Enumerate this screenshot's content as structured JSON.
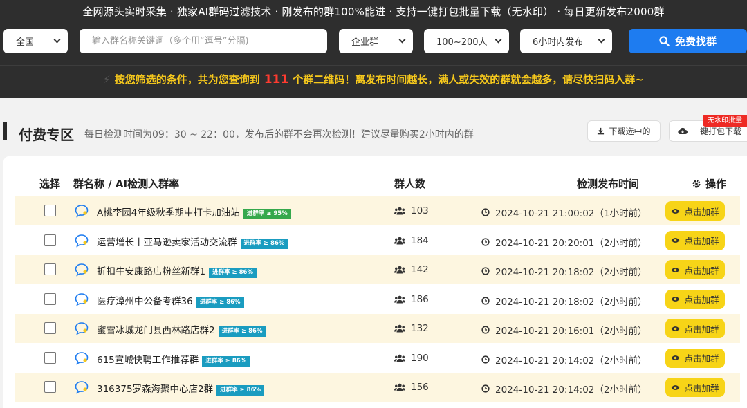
{
  "header": {
    "tagline": "全网源头实时采集 · 独家AI群码过滤技术 · 刚发布的群100%能进 · 支持一键打包批量下载（无水印） · 每日更新发布2000群"
  },
  "filters": {
    "region": "全国",
    "search_placeholder": "输入群名称关键词（多个用“逗号”分隔)",
    "group_type": "企业群",
    "member_range": "100~200人",
    "publish_time": "6小时内发布",
    "find_label": "免费找群"
  },
  "notice": {
    "prefix": "按您筛选的条件，共为您查询到",
    "count": "111",
    "suffix": "个群二维码！离发布时间越长，满人或失效的群就会越多，请尽快扫码入群~"
  },
  "section": {
    "title": "付费专区",
    "note": "每日检测时间为09：30 ~ 22：00，发布后的群不会再次检测！建议尽量购买2小时内的群",
    "download_selected": "下载选中的",
    "pack_download": "一键打包下载",
    "no_watermark_badge": "无水印批量"
  },
  "table": {
    "headers": {
      "select": "选择",
      "name": "群名称 / AI检测入群率",
      "members": "群人数",
      "time": "检测发布时间",
      "action": "操作"
    },
    "join_label": "点击加群",
    "rows": [
      {
        "name": "A桃李园4年级秋季期中打卡加油站",
        "rate": "进群率 ≥ 95%",
        "rate_color": "#35a84c",
        "members": "103",
        "time": "2024-10-21 21:00:02（1小时前）"
      },
      {
        "name": "运营增长丨亚马逊卖家活动交流群",
        "rate": "进群率 ≥ 86%",
        "rate_color": "#1a9cc0",
        "members": "184",
        "time": "2024-10-21 20:20:01（2小时前）"
      },
      {
        "name": "折扣牛安康路店粉丝新群1",
        "rate": "进群率 ≥ 86%",
        "rate_color": "#1a9cc0",
        "members": "142",
        "time": "2024-10-21 20:18:02（2小时前）"
      },
      {
        "name": "医疗漳州中公备考群36",
        "rate": "进群率 ≥ 86%",
        "rate_color": "#1a9cc0",
        "members": "186",
        "time": "2024-10-21 20:18:02（2小时前）"
      },
      {
        "name": "蜜雪冰城龙门县西林路店群2",
        "rate": "进群率 ≥ 86%",
        "rate_color": "#1a9cc0",
        "members": "132",
        "time": "2024-10-21 20:16:01（2小时前）"
      },
      {
        "name": "615宣城快聘工作推荐群",
        "rate": "进群率 ≥ 86%",
        "rate_color": "#1a9cc0",
        "members": "190",
        "time": "2024-10-21 20:14:02（2小时前）"
      },
      {
        "name": "316375罗森海聚中心店2群",
        "rate": "进群率 ≥ 86%",
        "rate_color": "#1a9cc0",
        "members": "156",
        "time": "2024-10-21 20:14:02（2小时前）"
      }
    ]
  },
  "colors": {
    "band": "#2e2e2e",
    "accent_blue": "#1e7cf0",
    "notice_yellow": "#f6c81c",
    "count_red": "#ff3b30",
    "join_yellow": "#f7d417",
    "row_alt": "#fdf6e0"
  }
}
